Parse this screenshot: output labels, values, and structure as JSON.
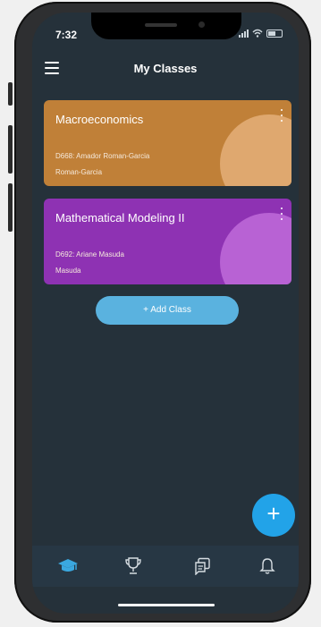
{
  "status_bar": {
    "time": "7:32"
  },
  "header": {
    "title": "My Classes"
  },
  "classes": [
    {
      "name": "Macroeconomics",
      "code": "D668: Amador Roman-Garcia",
      "teacher": "Roman-Garcia",
      "color": "#c08038",
      "circle_color": "#dfa86f"
    },
    {
      "name": "Mathematical Modeling II",
      "code": "D692: Ariane Masuda",
      "teacher": "Masuda",
      "color": "#8e32b3",
      "circle_color": "#b862d4"
    }
  ],
  "add_class_label": "+ Add Class",
  "fab_label": "+",
  "bottom_nav": [
    "classes-icon",
    "trophy-icon",
    "chat-icon",
    "bell-icon"
  ],
  "colors": {
    "screen_bg": "#25313a",
    "nav_bg": "#273744",
    "accent": "#22a3e8",
    "active_icon": "#3aa8e0"
  }
}
